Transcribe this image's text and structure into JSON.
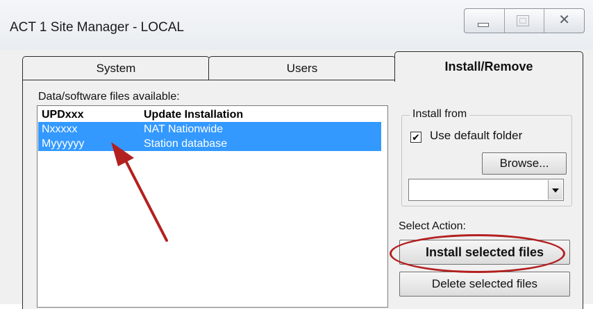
{
  "window": {
    "title": "ACT 1 Site Manager - LOCAL",
    "controls": {
      "minimize_icon": "minimize-icon",
      "maximize_icon": "maximize-icon",
      "close_glyph": "✕"
    }
  },
  "tabs": [
    {
      "label": "System",
      "selected": false
    },
    {
      "label": "Users",
      "selected": false
    },
    {
      "label": "Install/Remove",
      "selected": true
    }
  ],
  "files": {
    "label": "Data/software files available:",
    "rows": [
      {
        "code": "UPDxxx",
        "description": "Update Installation",
        "selected": false
      },
      {
        "code": "Nxxxxx",
        "description": "NAT Nationwide",
        "selected": true
      },
      {
        "code": "Myyyyyy",
        "description": "Station database",
        "selected": true
      }
    ]
  },
  "install_from": {
    "legend": "Install from",
    "use_default_folder_label": "Use default folder",
    "use_default_folder_checked": true,
    "check_glyph": "✔",
    "browse_label": "Browse...",
    "path_value": ""
  },
  "actions": {
    "label": "Select Action:",
    "install_label": "Install selected files",
    "delete_label": "Delete selected files"
  },
  "annotation": {
    "oval_color": "#b32020",
    "arrow_color": "#b32020"
  },
  "colors": {
    "selection": "#3399ff",
    "panel": "#f0f0f0"
  }
}
